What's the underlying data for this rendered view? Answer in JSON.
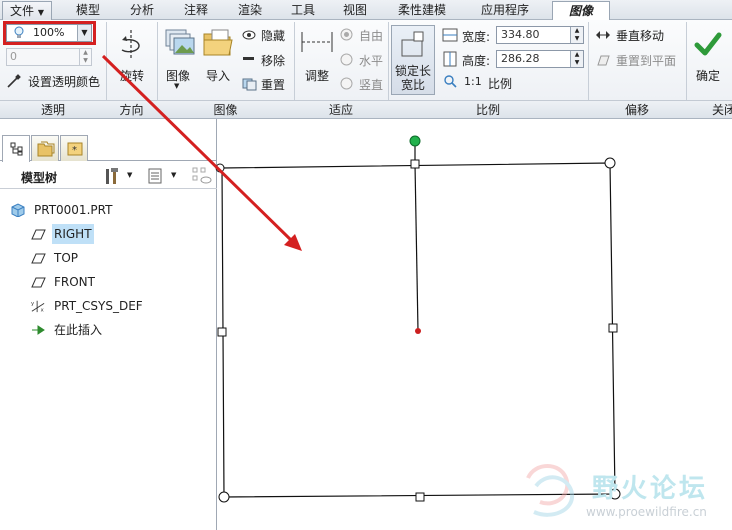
{
  "menu": {
    "tabs": [
      "文件",
      "模型",
      "分析",
      "注释",
      "渲染",
      "工具",
      "视图",
      "柔性建模",
      "应用程序",
      "图像"
    ],
    "active_tab": "图像"
  },
  "ribbon": {
    "transparency": {
      "value": "100%",
      "input_value": "0",
      "set_color_label": "设置透明颜色",
      "group_label": "透明"
    },
    "direction": {
      "rotate_label": "旋转",
      "group_label": "方向"
    },
    "image": {
      "image_label": "图像",
      "import_label": "导入",
      "hide_label": "隐藏",
      "remove_label": "移除",
      "reset_label": "重置",
      "group_label": "图像"
    },
    "fit": {
      "adjust_label": "调整",
      "free_label": "自由",
      "horizontal_label": "水平",
      "vertical_label": "竖直",
      "group_label": "适应"
    },
    "scale": {
      "lock_label_1": "锁定长",
      "lock_label_2": "宽比",
      "width_label": "宽度:",
      "width_value": "334.80",
      "height_label": "高度:",
      "height_value": "286.28",
      "ratio_icon": "1:1",
      "ratio_label": "比例",
      "group_label": "比例"
    },
    "offset": {
      "vertical_move_label": "垂直移动",
      "reset_plane_label": "重置到平面",
      "group_label": "偏移"
    },
    "confirm": {
      "ok_label": "确定",
      "close_group_label": "关闭"
    }
  },
  "model_tree": {
    "title": "模型树",
    "items": [
      {
        "label": "PRT0001.PRT",
        "icon": "part-icon"
      },
      {
        "label": "RIGHT",
        "icon": "datum-plane-icon",
        "selected": true
      },
      {
        "label": "TOP",
        "icon": "datum-plane-icon"
      },
      {
        "label": "FRONT",
        "icon": "datum-plane-icon"
      },
      {
        "label": "PRT_CSYS_DEF",
        "icon": "csys-icon"
      },
      {
        "label": "在此插入",
        "icon": "insert-here-arrow-icon"
      }
    ]
  },
  "watermark": {
    "title": "野火论坛",
    "url": "www.proewildfire.cn"
  },
  "colors": {
    "highlight": "#d42020",
    "arrow": "#d42020",
    "selection": "#bfe0f7",
    "ok_check": "#2e9a3a",
    "handle_green": "#22b14c",
    "handle_red": "#cc1f1f"
  }
}
